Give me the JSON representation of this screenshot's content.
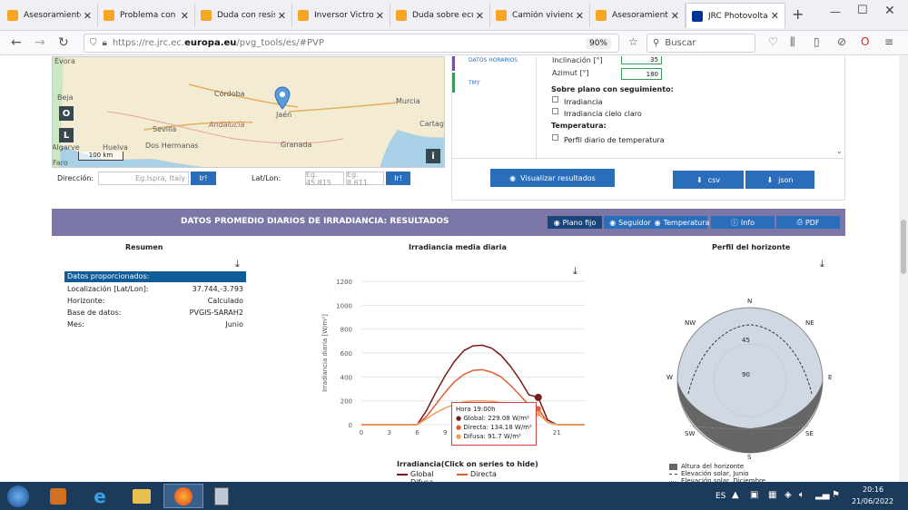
{
  "browser": {
    "tabs": [
      {
        "label": "Asesoramiento s",
        "color": "#f5a623"
      },
      {
        "label": "Problema con di",
        "color": "#f5a623"
      },
      {
        "label": "Duda con resister",
        "color": "#f5a623"
      },
      {
        "label": "Inversor Victron",
        "color": "#f5a623"
      },
      {
        "label": "Duda sobre ecua",
        "color": "#f5a623"
      },
      {
        "label": "Camión vivienda.",
        "color": "#f5a623"
      },
      {
        "label": "Asesoramiento s",
        "color": "#f5a623"
      },
      {
        "label": "JRC Photovoltaic",
        "color": "#003399"
      }
    ],
    "url_prefix": "https://re.jrc.ec.",
    "url_domain": "europa.eu",
    "url_suffix": "/pvg_tools/es/#PVP",
    "zoom": "90%",
    "search_placeholder": "Buscar"
  },
  "map": {
    "labels": [
      "Évora",
      "Beja",
      "Córdoba",
      "Jaén",
      "Sevilla",
      "Andalucía",
      "Murcia",
      "Cartagena",
      "Dos Hermanas",
      "Huelva",
      "Granada",
      "Algarve",
      "Faro"
    ],
    "scale": "100 km",
    "btn_o": "O",
    "btn_l": "L",
    "btn_i": "i"
  },
  "location_bar": {
    "direccion_label": "Dirección:",
    "direccion_placeholder": "Eg.Ispra, Italy",
    "go": "Ir!",
    "latlon_label": "Lat/Lon:",
    "lat_placeholder": "Eg. 45.815",
    "lon_placeholder": "Eg. 8.611"
  },
  "form": {
    "side_tabs": [
      "DATOS HORARIOS",
      "TMY"
    ],
    "inclinacion_label": "Inclinación [°]",
    "inclinacion_value": "35",
    "azimut_label": "Azimut [°]",
    "azimut_value": "180",
    "tracking_title": "Sobre plano con seguimiento:",
    "check_irradiancia": "Irradiancia",
    "check_cielo": "Irradiancia cielo claro",
    "temp_title": "Temperatura:",
    "check_temp": "Perfil diario de temperatura",
    "visualize": "Visualizar resultados",
    "csv": "csv",
    "json": "json"
  },
  "results": {
    "title": "DATOS PROMEDIO DIARIOS DE IRRADIANCIA: RESULTADOS",
    "tabs": [
      "Plano fijo",
      "Seguidor",
      "Temperatura",
      "Info",
      "PDF"
    ]
  },
  "summary": {
    "title": "Resumen",
    "header": "Datos proporcionados:",
    "rows": [
      {
        "k": "Localización [Lat/Lon]:",
        "v": "37.744,-3.793"
      },
      {
        "k": "Horizonte:",
        "v": "Calculado"
      },
      {
        "k": "Base de datos:",
        "v": "PVGIS-SARAH2"
      },
      {
        "k": "Mes:",
        "v": "Junio"
      }
    ]
  },
  "chart_data": {
    "type": "line",
    "title": "Irradiancia media diaria",
    "ylabel": "Irradiancia diaria [W/m²]",
    "xlabel": "",
    "ylim": [
      0,
      1200
    ],
    "xlim": [
      0,
      24
    ],
    "yticks": [
      0,
      200,
      400,
      600,
      800,
      1000,
      1200
    ],
    "xticks": [
      0,
      3,
      6,
      9,
      12,
      15,
      18,
      21
    ],
    "legend_title": "Irradiancia(Click on series to hide)",
    "series": [
      {
        "name": "Global",
        "color": "#7b1a1a",
        "x": [
          0,
          5,
          6,
          7,
          8,
          9,
          10,
          11,
          12,
          13,
          14,
          15,
          16,
          17,
          18,
          19,
          20,
          21,
          24
        ],
        "values": [
          0,
          0,
          0,
          120,
          270,
          410,
          530,
          620,
          660,
          665,
          640,
          580,
          490,
          380,
          250,
          229.08,
          40,
          0,
          0
        ]
      },
      {
        "name": "Directa",
        "color": "#e06030",
        "x": [
          0,
          5,
          6,
          7,
          8,
          9,
          10,
          11,
          12,
          13,
          14,
          15,
          16,
          17,
          18,
          19,
          20,
          21,
          24
        ],
        "values": [
          0,
          0,
          0,
          70,
          170,
          270,
          360,
          420,
          455,
          460,
          440,
          400,
          330,
          250,
          165,
          134.18,
          20,
          0,
          0
        ]
      },
      {
        "name": "Difusa",
        "color": "#f0a060",
        "x": [
          0,
          5,
          6,
          7,
          8,
          9,
          10,
          11,
          12,
          13,
          14,
          15,
          16,
          17,
          18,
          19,
          20,
          21,
          24
        ],
        "values": [
          0,
          0,
          0,
          50,
          100,
          140,
          170,
          190,
          200,
          200,
          195,
          185,
          165,
          135,
          95,
          91.7,
          20,
          0,
          0
        ]
      }
    ],
    "tooltip": {
      "title": "Hora 19:00h",
      "global": "Global: 229.08 W/m²",
      "directa": "Directa: 134.18 W/m²",
      "difusa": "Difusa: 91.7 W/m²"
    }
  },
  "horizon": {
    "title": "Perfil del horizonte",
    "directions": [
      "N",
      "NE",
      "E",
      "SE",
      "S",
      "SW",
      "W",
      "NW"
    ],
    "ring_labels": [
      "45",
      "90"
    ],
    "legend": [
      "Altura del horizonte",
      "Elevación solar, Junio",
      "Elevación solar, Diciembre"
    ]
  },
  "taskbar": {
    "lang": "ES",
    "time": "20:16",
    "date": "21/06/2022"
  }
}
